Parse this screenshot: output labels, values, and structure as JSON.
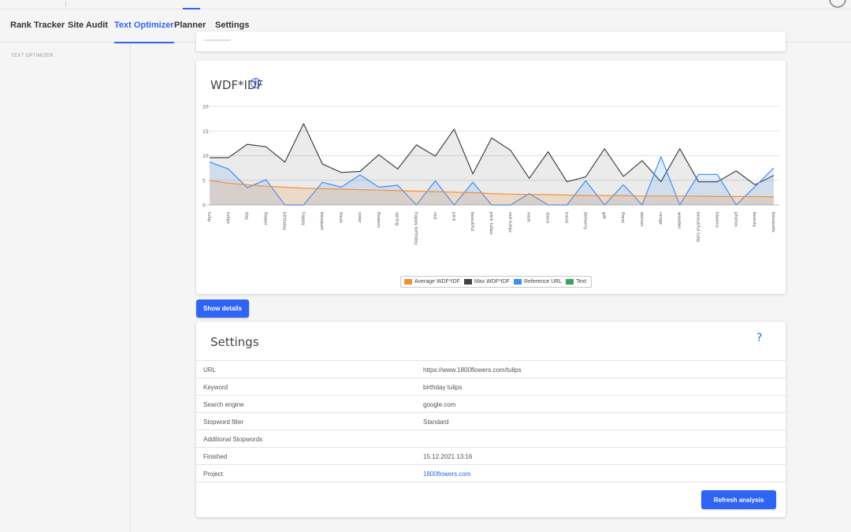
{
  "nav": {
    "items": [
      {
        "label": "Rank Tracker",
        "active": false
      },
      {
        "label": "Site Audit",
        "active": false
      },
      {
        "label": "Text Optimizer",
        "active": true
      },
      {
        "label": "Planner",
        "active": false
      },
      {
        "label": "Settings",
        "active": false
      }
    ]
  },
  "sidebar": {
    "section_label": "TEXT OPTIMIZER"
  },
  "chart_card": {
    "title": "WDF*IDF",
    "info_icon": "info-icon"
  },
  "chart_data": {
    "type": "line",
    "ylim": [
      0,
      20
    ],
    "yticks": [
      0,
      5,
      10,
      15,
      20
    ],
    "grid": true,
    "legend_position": "bottom-center",
    "categories": [
      "tulip",
      "tulips",
      "day",
      "flower",
      "birthday",
      "happy",
      "bouquet",
      "fresh",
      "color",
      "flowers",
      "spring",
      "happy birthday",
      "red",
      "pink",
      "beautiful",
      "pink tulips",
      "red tulips",
      "vase",
      "stock",
      "hand",
      "delivery",
      "gift",
      "floral",
      "deliver",
      "range",
      "wooden",
      "beautiful tulip",
      "blooms",
      "photos",
      "beauty",
      "bouquets"
    ],
    "series": [
      {
        "name": "Average WDF*IDF",
        "color": "#f0913a",
        "values": [
          5.0,
          4.4,
          4.1,
          3.8,
          3.6,
          3.4,
          3.3,
          3.2,
          3.1,
          3.0,
          2.9,
          2.8,
          2.7,
          2.6,
          2.5,
          2.3,
          2.2,
          2.1,
          2.1,
          2.0,
          1.9,
          1.9,
          1.9,
          1.8,
          1.8,
          1.8,
          1.8,
          1.7,
          1.7,
          1.7,
          1.6
        ]
      },
      {
        "name": "Max WDF*IDF",
        "color": "#3f4449",
        "values": [
          9.6,
          9.6,
          12.3,
          11.8,
          8.7,
          16.5,
          8.3,
          6.6,
          6.8,
          10.2,
          7.3,
          12.2,
          9.9,
          15.4,
          6.3,
          13.6,
          11.1,
          5.4,
          10.8,
          4.7,
          5.7,
          11.4,
          5.8,
          9.0,
          4.7,
          11.4,
          4.7,
          4.7,
          6.9,
          4.1,
          6.0
        ]
      },
      {
        "name": "Reference URL",
        "color": "#3d8ef5",
        "values": [
          8.7,
          7.3,
          3.5,
          5.1,
          0,
          0,
          4.6,
          3.6,
          6.1,
          3.6,
          4.0,
          0,
          4.9,
          0,
          4.6,
          0,
          0,
          2.3,
          0,
          0,
          4.9,
          0,
          4.1,
          0,
          9.8,
          0,
          6.2,
          6.2,
          0,
          3.7,
          7.5
        ]
      },
      {
        "name": "Text",
        "color": "#3aa35d",
        "values": []
      }
    ]
  },
  "show_details_label": "Show details",
  "settings": {
    "title": "Settings",
    "help_icon": "?",
    "rows": [
      {
        "key": "URL",
        "value": "https://www.1800flowers.com/tulips"
      },
      {
        "key": "Keyword",
        "value": "birthday tulips"
      },
      {
        "key": "Search engine",
        "value": "google.com"
      },
      {
        "key": "Stopword filter",
        "value": "Standard"
      },
      {
        "key": "Additional Stopwords",
        "value": ""
      },
      {
        "key": "Finished",
        "value": "15.12.2021 13:16"
      },
      {
        "key": "Project",
        "value": "1800flowers.com"
      }
    ],
    "refresh_label": "Refresh analysis"
  }
}
